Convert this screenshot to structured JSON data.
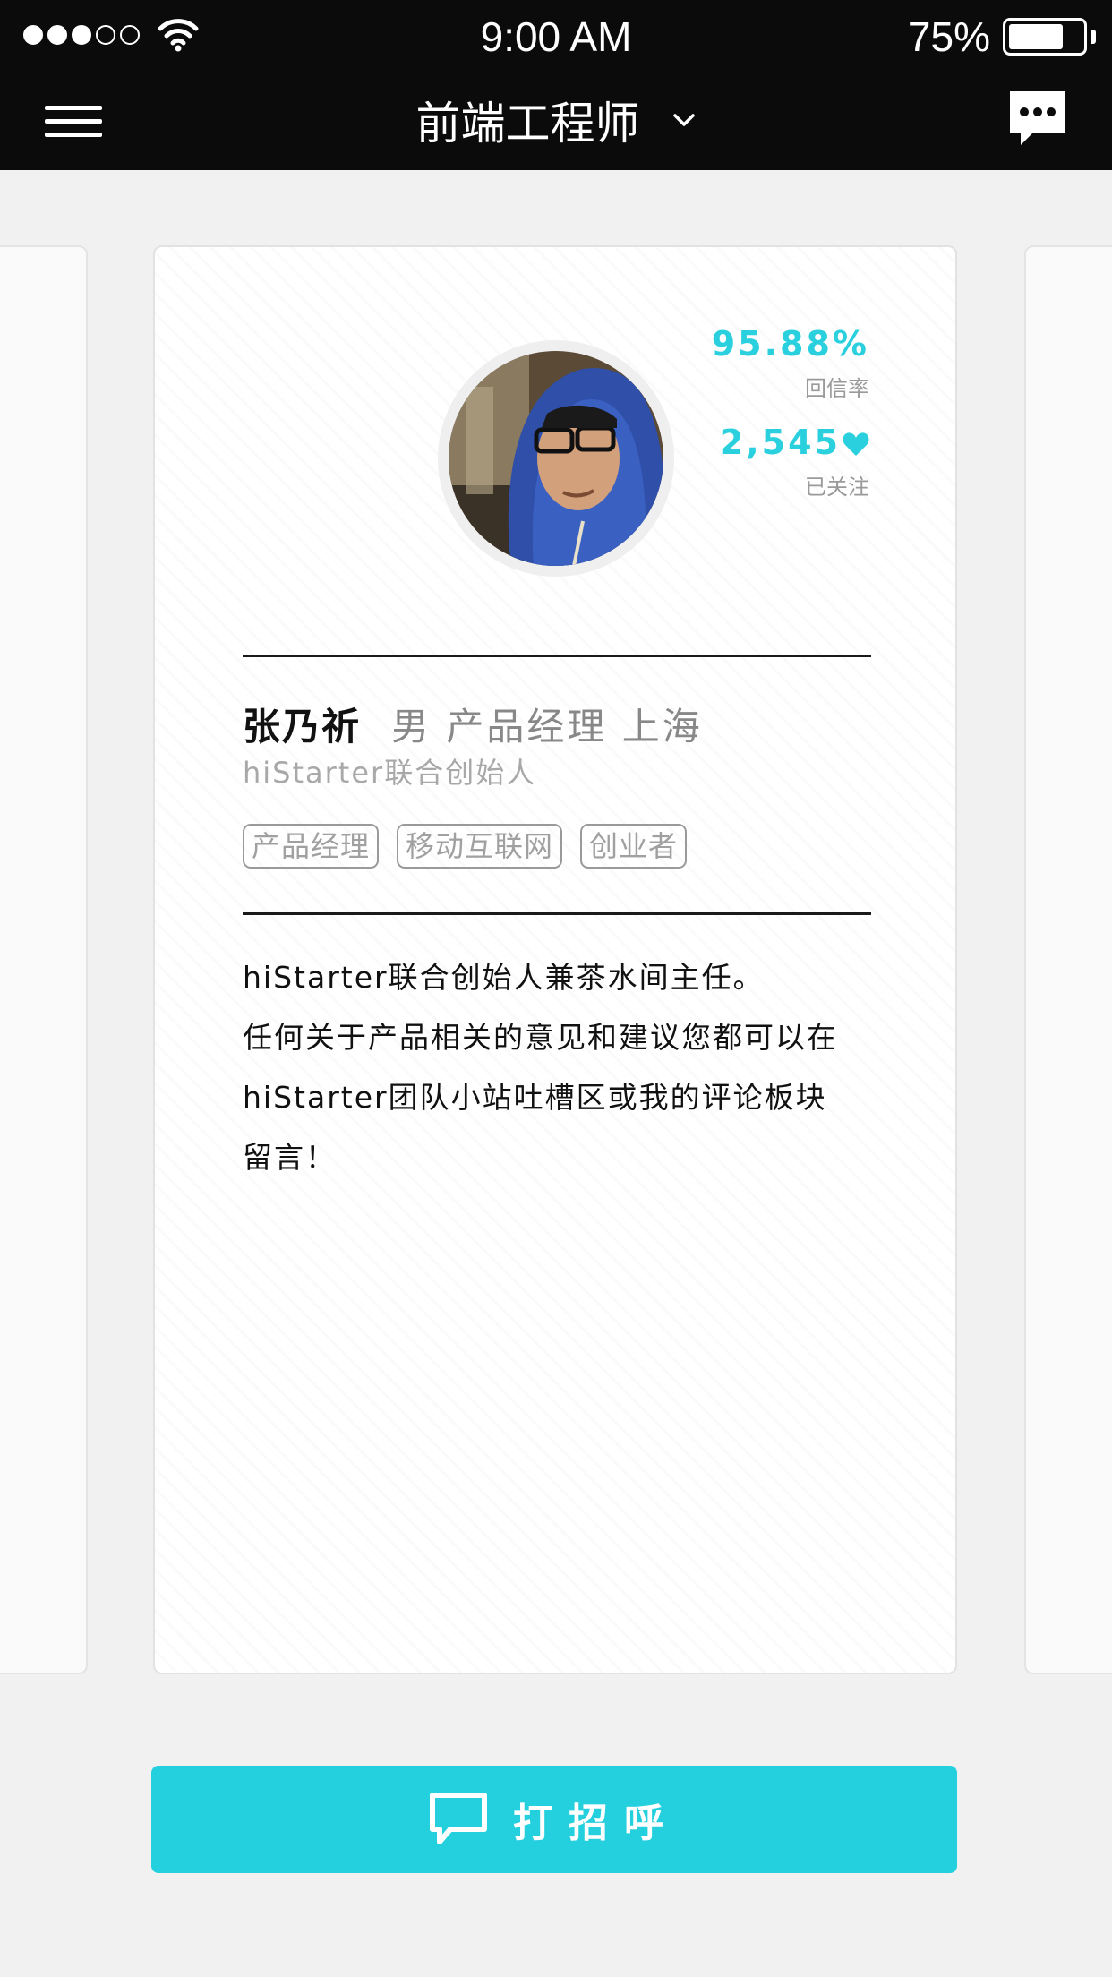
{
  "status_bar": {
    "time": "9:00 AM",
    "battery_percent": "75%",
    "battery_level": 0.75,
    "signal_bars_filled": 3,
    "signal_bars_total": 5
  },
  "nav": {
    "title": "前端工程师"
  },
  "profile": {
    "reply_rate": "95.88%",
    "reply_rate_label": "回信率",
    "followers": "2,545",
    "followers_label": "已关注",
    "name": "张乃祈",
    "meta": "男 产品经理 上海",
    "subtitle": "hiStarter联合创始人",
    "tags": [
      "产品经理",
      "移动互联网",
      "创业者"
    ],
    "bio_lines": [
      "hiStarter联合创始人兼茶水间主任。",
      "任何关于产品相关的意见和建议您都可以在",
      "hiStarter团队小站吐槽区或我的评论板块",
      "留言！"
    ]
  },
  "cta": {
    "label": "打招呼"
  },
  "colors": {
    "accent": "#24d0dd",
    "nav_bg": "#0b0b0b",
    "page_bg": "#f1f1f1"
  }
}
